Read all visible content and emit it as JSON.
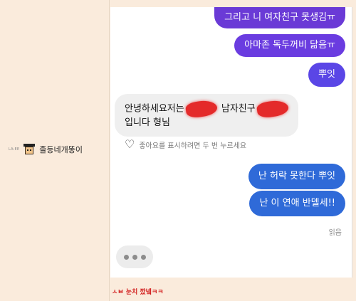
{
  "author": {
    "tag": "LA:EE",
    "name": "졸등네개똥이",
    "avatar_icon": "pixel-avatar-icon"
  },
  "messages": {
    "sent_1": "그리고 니 여자친구 못생김ㅠ",
    "sent_2": "아마존 독두꺼비 닮음ㅠ",
    "sent_3": "뿌잇",
    "received_line1_a": "안녕하세요저는",
    "received_line1_b": "남자친구",
    "received_line2": "입니다 형님",
    "sent_4": "난 허락 못한다 뿌잇",
    "sent_5": "난 이 연애 반델세!!"
  },
  "hint": {
    "icon": "heart-outline-icon",
    "text": "좋아요를 표시하려면 두 번 누르세요"
  },
  "status": {
    "read": "읽음"
  },
  "caption": "ㅅㅂ 눈치 깠넼ㅋㅋ",
  "colors": {
    "background": "#faebdc",
    "sent_purple": "#6a3ad6",
    "sent_blue": "#2f6ad8",
    "received": "#efefef",
    "redaction": "#e42a2a",
    "caption": "#d11a1a"
  }
}
